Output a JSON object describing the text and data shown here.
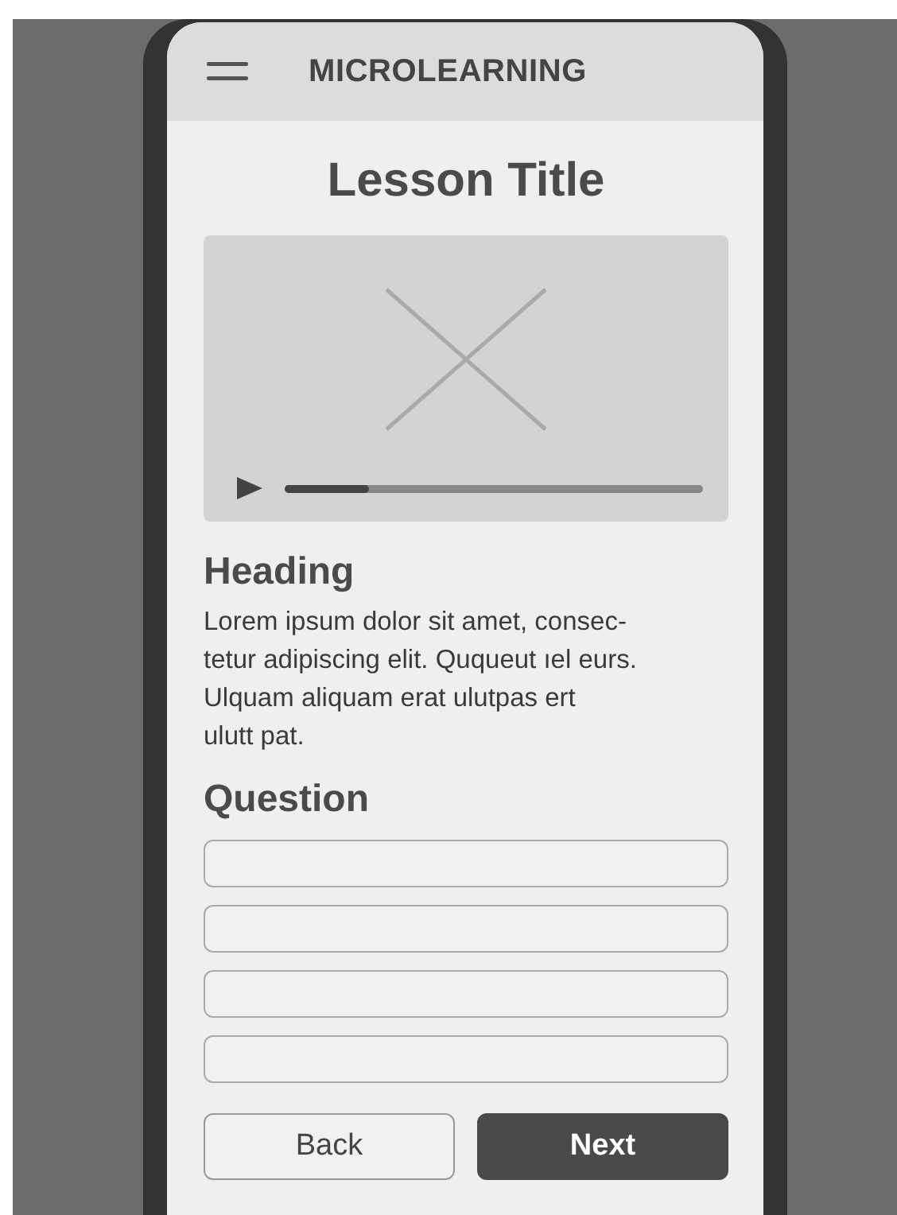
{
  "app_bar": {
    "title": "MICROLEARNING"
  },
  "lesson": {
    "title": "Lesson Title"
  },
  "video": {
    "kind": "picture",
    "progress": {
      "level": 0.2
    }
  },
  "section": {
    "heading": "Heading",
    "body": "Lorem ipsum dolor sit amet, consec-\ntetur adipiscing elit. Ququeut ıel eurs.\nUlquam aliquam erat ulutpas ert\nulutt pat."
  },
  "question": {
    "heading": "Question",
    "answers": [
      {
        "kind": "field"
      },
      {
        "kind": "field"
      },
      {
        "kind": "field"
      },
      {
        "kind": "field"
      }
    ]
  },
  "buttons": [
    {
      "label": "Back",
      "kind": "secondary"
    },
    {
      "label": "Next",
      "kind": "primary"
    }
  ]
}
